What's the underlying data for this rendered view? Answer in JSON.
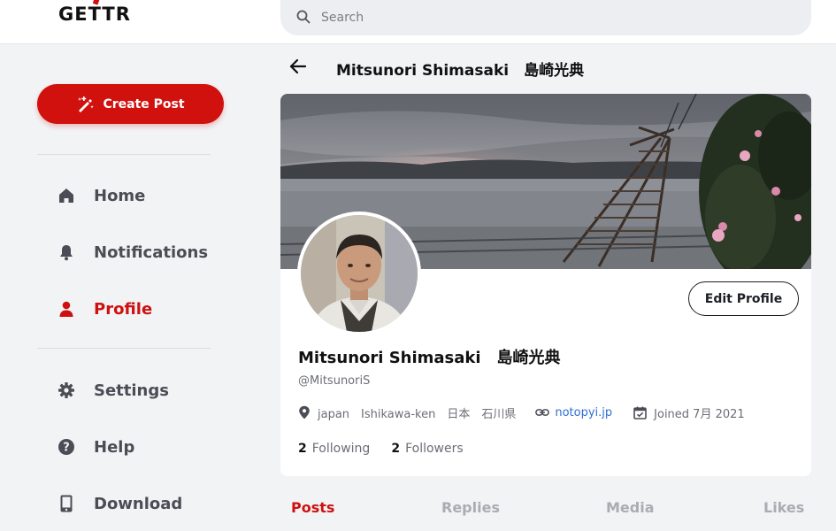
{
  "brand": {
    "logo_text": "GETTR"
  },
  "search": {
    "placeholder": "Search"
  },
  "sidebar": {
    "create_post_label": "Create Post",
    "items": [
      {
        "label": "Home",
        "icon": "home-icon"
      },
      {
        "label": "Notifications",
        "icon": "bell-icon"
      },
      {
        "label": "Profile",
        "icon": "user-icon",
        "active": true
      },
      {
        "label": "Settings",
        "icon": "gear-icon"
      },
      {
        "label": "Help",
        "icon": "question-icon"
      },
      {
        "label": "Download",
        "icon": "phone-icon"
      }
    ]
  },
  "header": {
    "title": "Mitsunori Shimasaki　島崎光典"
  },
  "profile": {
    "display_name": "Mitsunori Shimasaki　島崎光典",
    "handle": "@MitsunoriS",
    "location": "japan　Ishikawa-ken　日本　石川県",
    "website": "notopyi.jp",
    "joined": "Joined 7月 2021",
    "following_count": "2",
    "following_label": "Following",
    "followers_count": "2",
    "followers_label": "Followers",
    "edit_label": "Edit Profile"
  },
  "tabs": [
    {
      "label": "Posts",
      "active": true
    },
    {
      "label": "Replies"
    },
    {
      "label": "Media"
    },
    {
      "label": "Likes"
    }
  ],
  "colors": {
    "accent": "#cf1010",
    "link": "#2f6fd6",
    "muted": "#6b6e76"
  }
}
